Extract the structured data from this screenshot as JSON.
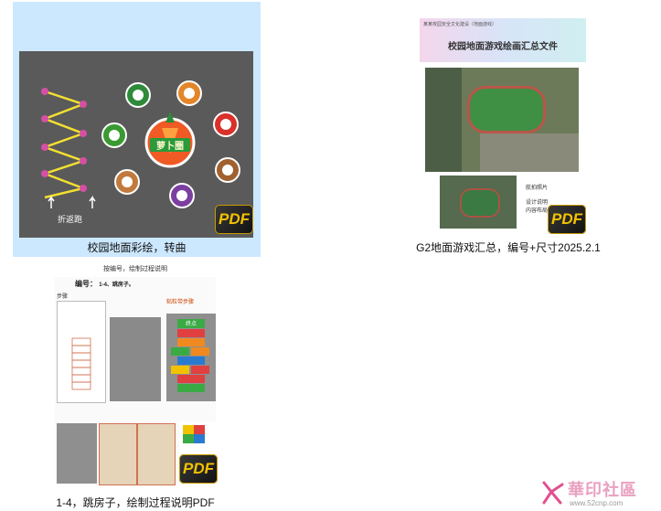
{
  "tiles": [
    {
      "caption": "校园地面彩绘，转曲",
      "art": {
        "center_label": "萝卜圈",
        "bottom_label": "折返跑",
        "icon_names": [
          "cabbage-icon",
          "pumpkin-icon",
          "tomato-icon",
          "potato-icon",
          "onion-icon",
          "mushroom-icon",
          "pepper-icon",
          "carrot-icon"
        ]
      },
      "badge": "PDF",
      "selected": true
    },
    {
      "caption": "G2地面游戏汇总，编号+尺寸2025.2.1",
      "doc": {
        "header_small": "某某校园安全文化建设（地面游戏）",
        "title": "校园地面游戏绘画汇总文件",
        "note1": "航拍照片",
        "note2": "设计说明",
        "note3": "内容布局"
      },
      "badge": "PDF"
    },
    {
      "caption": "1-4，跳房子，绘制过程说明PDF",
      "doc": {
        "top_text": "按编号，绘制过程说明",
        "number_label": "编号：",
        "number_value": "1-4、跳房子。",
        "step_label": "步骤",
        "header_right": "粘粒带步骤",
        "hop_numbers": [
          "终点",
          "8",
          "9",
          "6",
          "7",
          "5",
          "3",
          "4",
          "2",
          "1"
        ]
      },
      "badge": "PDF"
    }
  ],
  "watermark": {
    "brand": "華印社區",
    "url": "www.52cnp.com"
  },
  "colors": {
    "selection": "#cce8ff",
    "art_bg": "#5a5a5a",
    "pdf_yellow": "#f2c200"
  }
}
